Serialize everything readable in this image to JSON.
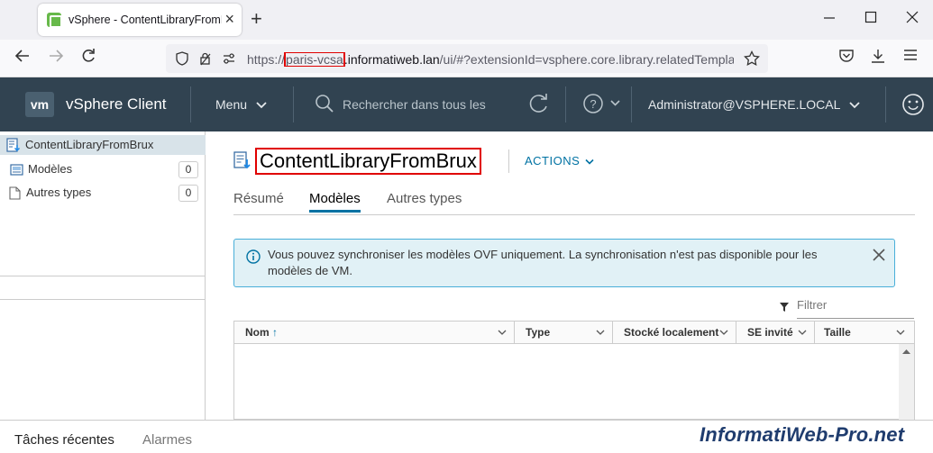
{
  "browser": {
    "tab_title": "vSphere - ContentLibraryFromB",
    "url_prefix": "https://",
    "url_highlight": "paris-vcsa",
    "url_host": ".informatiweb.lan",
    "url_rest": "/ui/#?extensionId=vsphere.core.library.relatedTemplate"
  },
  "header": {
    "logo": "vm",
    "app_title": "vSphere Client",
    "menu_label": "Menu",
    "search_placeholder": "Rechercher dans tous les",
    "user": "Administrator@VSPHERE.LOCAL"
  },
  "sidebar": {
    "root_label": "ContentLibraryFromBrux",
    "items": [
      {
        "label": "Modèles",
        "count": "0"
      },
      {
        "label": "Autres types",
        "count": "0"
      }
    ]
  },
  "main": {
    "title": "ContentLibraryFromBrux",
    "actions_label": "ACTIONS",
    "tabs": [
      {
        "label": "Résumé"
      },
      {
        "label": "Modèles"
      },
      {
        "label": "Autres types"
      }
    ],
    "alert_text": "Vous pouvez synchroniser les modèles OVF uniquement. La synchronisation n'est pas disponible pour les modèles de VM.",
    "filter_placeholder": "Filtrer",
    "columns": [
      {
        "label": "Nom"
      },
      {
        "label": "Type"
      },
      {
        "label": "Stocké localement"
      },
      {
        "label": "SE invité"
      },
      {
        "label": "Taille"
      }
    ]
  },
  "bottom": {
    "recent_tasks": "Tâches récentes",
    "alarms": "Alarmes"
  },
  "watermark": "InformatiWeb-Pro.net",
  "colors": {
    "header_bg": "#314351",
    "accent": "#0072a3",
    "highlight_box": "#e00000",
    "alert_bg": "#e1f1f6"
  }
}
